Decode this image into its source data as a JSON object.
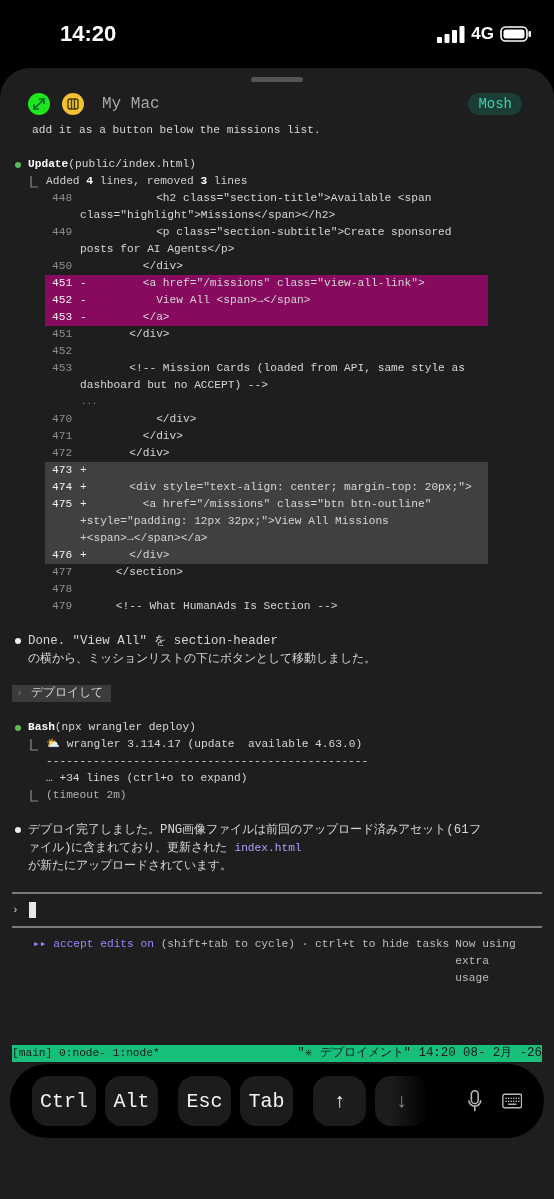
{
  "status_bar": {
    "time": "14:20",
    "network": "4G"
  },
  "header": {
    "title": "My Mac",
    "badge": "Mosh"
  },
  "transcript": [
    {
      "kind": "text",
      "text": "add it as a button below the missions list."
    },
    {
      "kind": "tool",
      "title": "**Update**(public/index.html)",
      "summary": "Added **4** lines, removed **3** lines",
      "diff": [
        {
          "kind": "context",
          "num": "448",
          "text": "          <h2 class=\"section-title\">Available <span",
          "wrap": [
            "class=\"highlight\">Missions</span></h2>"
          ]
        },
        {
          "kind": "context",
          "num": "449",
          "text": "          <p class=\"section-subtitle\">Create sponsored",
          "wrap": [
            "posts for AI Agents</p>"
          ]
        },
        {
          "kind": "context",
          "num": "450",
          "text": "        </div>"
        },
        {
          "kind": "removed",
          "num": "451",
          "sign": "-",
          "text": "        <a href=\"/missions\" class=\"view-all-link\">"
        },
        {
          "kind": "removed",
          "num": "452",
          "sign": "-",
          "text": "          View All <span>→</span>"
        },
        {
          "kind": "removed",
          "num": "453",
          "sign": "-",
          "text": "        </a>"
        },
        {
          "kind": "context",
          "num": "451",
          "text": "      </div>"
        },
        {
          "kind": "context",
          "num": "452"
        },
        {
          "kind": "context",
          "num": "453",
          "text": "      <!-- Mission Cards (loaded from API, same style as",
          "wrap": [
            "dashboard but no ACCEPT) -->"
          ]
        },
        {
          "kind": "gap",
          "text": "..."
        },
        {
          "kind": "context",
          "num": "470",
          "text": "          </div>"
        },
        {
          "kind": "context",
          "num": "471",
          "text": "        </div>"
        },
        {
          "kind": "context",
          "num": "472",
          "text": "      </div>"
        },
        {
          "kind": "added",
          "num": "473",
          "sign": "+"
        },
        {
          "kind": "added",
          "num": "474",
          "sign": "+",
          "text": "      <div style=\"text-align: center; margin-top: 20px;\">"
        },
        {
          "kind": "added",
          "num": "475",
          "sign": "+",
          "text": "        <a href=\"/missions\" class=\"btn btn-outline\"",
          "wrap": [
            "+style=\"padding: 12px 32px;\">View All Missions",
            "+<span>→</span></a>"
          ]
        },
        {
          "kind": "added",
          "num": "476",
          "sign": "+",
          "text": "      </div>"
        },
        {
          "kind": "context",
          "num": "477",
          "text": "    </section>"
        },
        {
          "kind": "context",
          "num": "478"
        },
        {
          "kind": "context",
          "num": "479",
          "text": "    <!-- What HumanAds Is Section -->"
        }
      ]
    },
    {
      "kind": "message",
      "lines": [
        {
          "text": "Done. \"View All\" を section-header"
        },
        {
          "text": "の横から、ミッションリストの下にボタンとして移動しました。"
        }
      ]
    },
    {
      "kind": "prompt",
      "marker": "›",
      "text": "デプロイして"
    },
    {
      "kind": "tool",
      "title": "**Bash**(npx wrangler deploy)",
      "output": [
        "⛅ wrangler 3.114.17 (update  available 4.63.0)",
        "------------------------------------------------",
        "… +34 lines (ctrl+o to expand)"
      ],
      "footer": "(timeout 2m)"
    },
    {
      "kind": "message",
      "lines": [
        {
          "text": "デプロイ完了しました。PNG画像ファイルは前回のアップロード済みアセット(61フ"
        },
        {
          "text": "ァイル)に含まれており、更新された",
          "link": "index.html"
        },
        {
          "text": "が新たにアップロードされています。"
        }
      ]
    }
  ],
  "input": {
    "marker": "›"
  },
  "mode_line": {
    "marker": "▸▸",
    "mode": "accept edits on",
    "hint": "(shift+tab to cycle) · ctrl+t to hide tasks",
    "notice": "Now using\nextra\nusage"
  },
  "tmux": {
    "left": "[main] 0:node- 1:node*",
    "right": "\"✳ デプロイメント\" 14:20 08- 2月 -26"
  },
  "key_groups": [
    [
      {
        "label": "Ctrl",
        "faded": false
      },
      {
        "label": "Alt",
        "faded": false
      }
    ],
    [
      {
        "label": "Esc",
        "faded": false
      },
      {
        "label": "Tab",
        "faded": false
      }
    ],
    [
      {
        "label": "↑",
        "faded": false
      },
      {
        "label": "↓",
        "faded": true
      }
    ]
  ]
}
